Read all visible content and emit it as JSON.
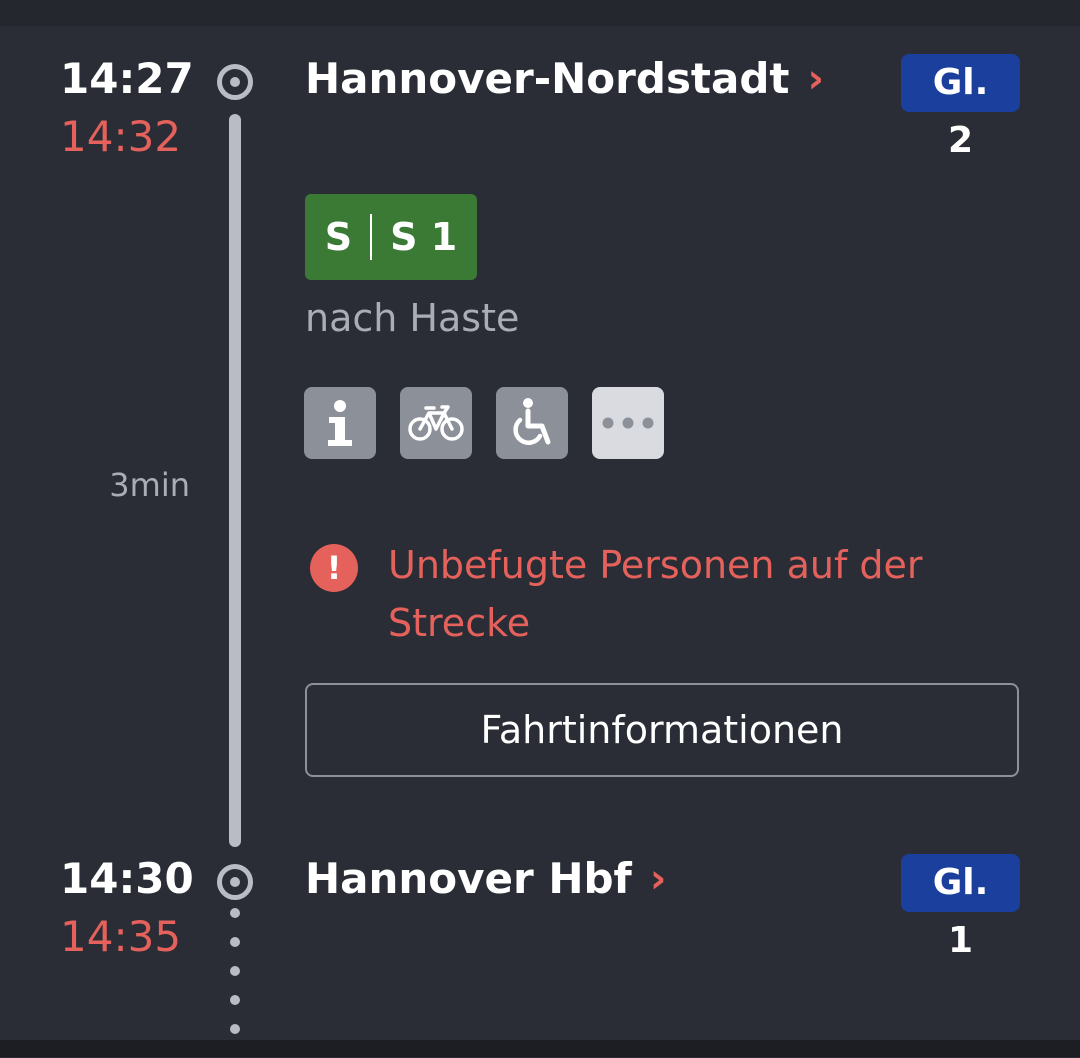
{
  "stops": [
    {
      "scheduled_time": "14:27",
      "real_time": "14:32",
      "station": "Hannover-Nordstadt",
      "platform": "Gl. 2"
    },
    {
      "scheduled_time": "14:30",
      "real_time": "14:35",
      "station": "Hannover Hbf",
      "platform": "Gl. 1"
    }
  ],
  "train": {
    "category": "S",
    "line": "S 1",
    "destination": "nach Haste",
    "badge_color": "#3b7a35"
  },
  "attributes": [
    "info-icon",
    "bicycle-icon",
    "wheelchair-icon",
    "more-icon"
  ],
  "duration": "3min",
  "warning": {
    "icon": "exclamation-icon",
    "text": "Unbefugte Personen auf der Strecke",
    "color": "#e5615b"
  },
  "trip_info_button": "Fahrtinformationen",
  "colors": {
    "background": "#2a2d36",
    "platform_badge": "#1b3f9c",
    "delay_red": "#e5615b"
  }
}
